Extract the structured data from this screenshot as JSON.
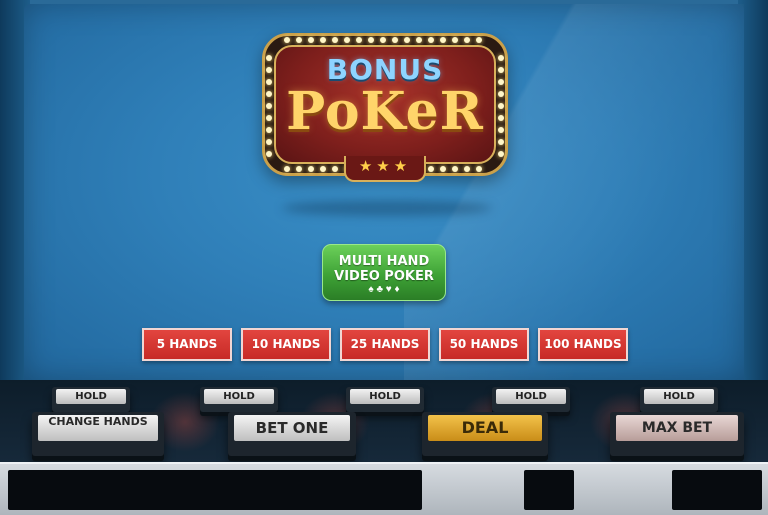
{
  "logo": {
    "line1": "BONUS",
    "line2": "PoKeR",
    "stars": "★★★"
  },
  "game_type": {
    "line1": "MULTI HAND",
    "line2": "VIDEO POKER",
    "suits": "♠ ♣ ♥ ♦"
  },
  "hand_options": [
    {
      "label": "5 HANDS"
    },
    {
      "label": "10 HANDS"
    },
    {
      "label": "25 HANDS"
    },
    {
      "label": "50 HANDS"
    },
    {
      "label": "100 HANDS"
    }
  ],
  "console": {
    "hold_label": "HOLD",
    "change_hands": "CHANGE HANDS",
    "bet_one": "BET ONE",
    "deal": "DEAL",
    "max_bet": "MAX BET"
  },
  "colors": {
    "screen": "#2f7fb8",
    "hand_button": "#d8322d",
    "badge_green": "#3ea236",
    "deal_gold": "#e2a82c"
  }
}
